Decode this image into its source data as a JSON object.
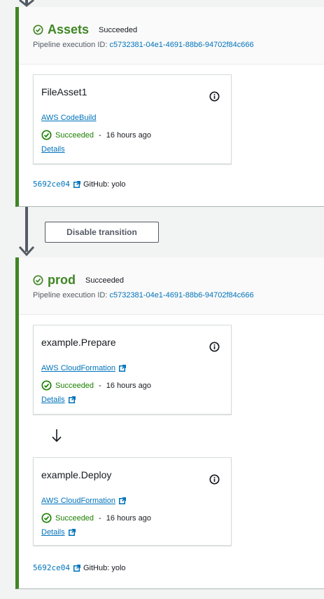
{
  "stages": [
    {
      "name": "Assets",
      "status": "Succeeded",
      "execution_label": "Pipeline execution ID:",
      "execution_id": "c5732381-04e1-4691-88b6-94702f84c666",
      "actions": [
        {
          "title": "FileAsset1",
          "provider": "AWS CodeBuild",
          "status": "Succeeded",
          "separator": "-",
          "time": "16 hours ago",
          "details": "Details"
        }
      ],
      "source_commit": "5692ce04",
      "source_branch": "GitHub: yolo"
    },
    {
      "name": "prod",
      "status": "Succeeded",
      "execution_label": "Pipeline execution ID:",
      "execution_id": "c5732381-04e1-4691-88b6-94702f84c666",
      "actions": [
        {
          "title": "example.Prepare",
          "provider": "AWS CloudFormation",
          "status": "Succeeded",
          "separator": "-",
          "time": "16 hours ago",
          "details": "Details"
        },
        {
          "title": "example.Deploy",
          "provider": "AWS CloudFormation",
          "status": "Succeeded",
          "separator": "-",
          "time": "16 hours ago",
          "details": "Details"
        }
      ],
      "source_commit": "5692ce04",
      "source_branch": "GitHub: yolo"
    }
  ],
  "transition_button": "Disable transition",
  "icons": {
    "stage_status": "check-circle-icon",
    "action_info": "info-icon",
    "external_link": "external-link-icon",
    "transition_arrow": "arrow-down-icon"
  },
  "colors": {
    "success": "#3f8624",
    "status_text": "#1d8102",
    "link": "#0073bb",
    "arrow": "#545b64"
  }
}
